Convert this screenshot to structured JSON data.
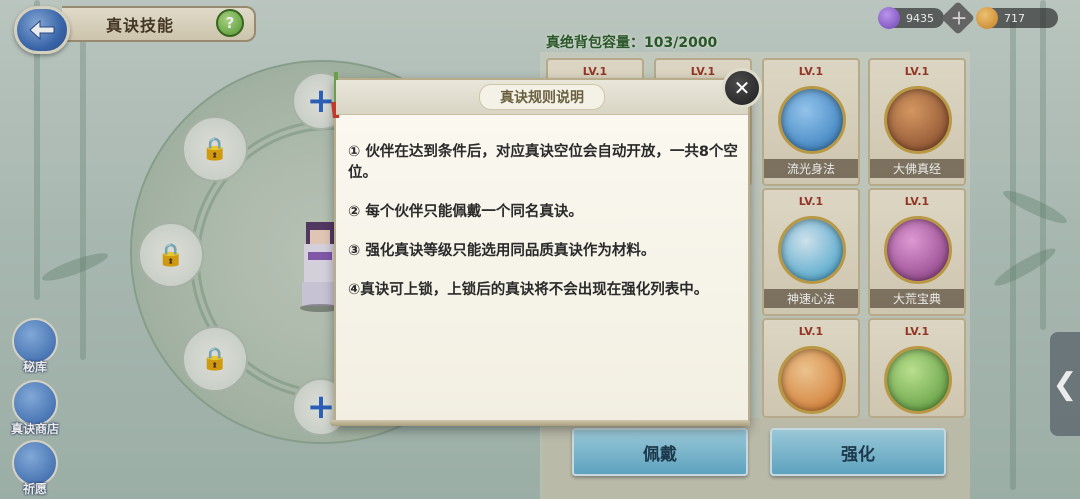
{
  "header": {
    "title": "真诀技能",
    "help_label": "?"
  },
  "resources": [
    {
      "icon": "purple-orb-icon",
      "value": "9435",
      "color": "#7b4bc4"
    },
    {
      "icon": "gold-coin-icon",
      "value": "717",
      "color": "#d88a2a"
    }
  ],
  "capacity": "真绝背包容量：103/2000",
  "side_menu": [
    {
      "label": "秘库",
      "icon": "scroll-icon"
    },
    {
      "label": "真诀商店",
      "icon": "shop-icon"
    },
    {
      "label": "祈愿",
      "icon": "banner-icon"
    }
  ],
  "cards": [
    {
      "lv": "LV.1",
      "name": "",
      "color": "#d7c46a"
    },
    {
      "lv": "LV.1",
      "name": "",
      "color": "#c5c5c5"
    },
    {
      "lv": "LV.1",
      "name": "流光身法",
      "color": "#2f7fc6"
    },
    {
      "lv": "LV.1",
      "name": "大佛真经",
      "color": "#8a4a2a"
    },
    {
      "lv": "LV.1",
      "name": "神速心法",
      "color": "#3aa7d6"
    },
    {
      "lv": "LV.1",
      "name": "大荒宝典",
      "color": "#8d3a86"
    },
    {
      "lv": "LV.1",
      "name": "",
      "color": "#e07a2a"
    },
    {
      "lv": "LV.1",
      "name": "",
      "color": "#5aa03a"
    }
  ],
  "actions": {
    "equip": "佩戴",
    "enhance": "强化"
  },
  "dialog": {
    "title": "真诀规则说明",
    "rules": [
      "① 伙伴在达到条件后，对应真诀空位会自动开放，一共8个空位。",
      "② 每个伙伴只能佩戴一个同名真诀。",
      "③ 强化真诀等级只能选用同品质真诀作为材料。",
      "④真诀可上锁，上锁后的真诀将不会出现在强化列表中。"
    ],
    "close_label": "✕"
  },
  "edge_tab": "❮"
}
